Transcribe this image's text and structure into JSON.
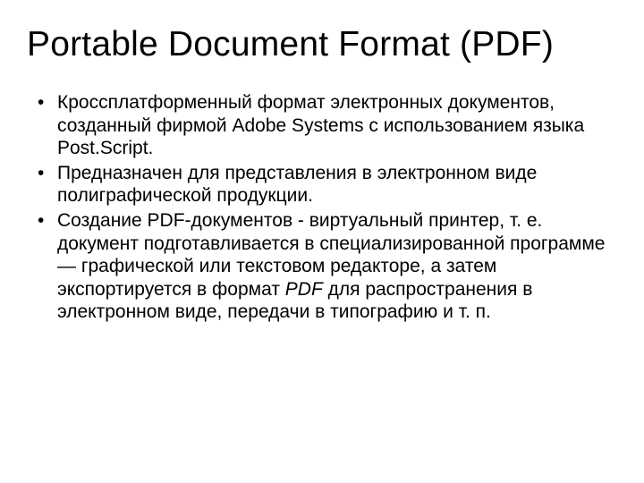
{
  "title": "Portable Document Format (PDF)",
  "bullet_marker": "•",
  "bullets": {
    "b0": "Кроссплатформенный формат электронных документов, созданный фирмой Adobe Systems с использованием языка Post.Script.",
    "b1": "Предназначен для представления в электронном виде полиграфической продукции.",
    "b2_a": "Создание PDF-документов - виртуальный принтер, т. е. документ подготавливается в специализированной программе — графической или текстовом редакторе, а затем экспортируется в формат ",
    "b2_i": "PDF",
    "b2_b": " для распространения в электронном виде, передачи в типографию и т. п."
  }
}
